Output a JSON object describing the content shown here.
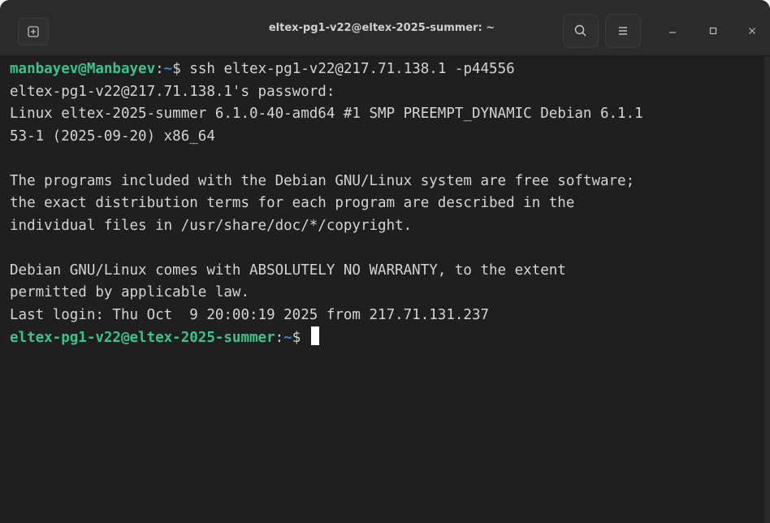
{
  "window": {
    "title": "eltex-pg1-v22@eltex-2025-summer: ~"
  },
  "titlebar": {
    "new_tab_icon": "new-tab-icon",
    "search_icon": "search-icon",
    "menu_icon": "hamburger-menu-icon",
    "minimize_icon": "minimize-icon",
    "maximize_icon": "maximize-icon",
    "close_icon": "close-icon"
  },
  "terminal": {
    "prompt1": {
      "user": "manbayev@Manbayev",
      "colon": ":",
      "path": "~",
      "symbol": "$ ",
      "command": "ssh eltex-pg1-v22@217.71.138.1 -p44556"
    },
    "output": [
      "eltex-pg1-v22@217.71.138.1's password:",
      "Linux eltex-2025-summer 6.1.0-40-amd64 #1 SMP PREEMPT_DYNAMIC Debian 6.1.1",
      "53-1 (2025-09-20) x86_64",
      "",
      "The programs included with the Debian GNU/Linux system are free software;",
      "the exact distribution terms for each program are described in the",
      "individual files in /usr/share/doc/*/copyright.",
      "",
      "Debian GNU/Linux comes with ABSOLUTELY NO WARRANTY, to the extent",
      "permitted by applicable law.",
      "Last login: Thu Oct  9 20:00:19 2025 from 217.71.131.237"
    ],
    "prompt2": {
      "user": "eltex-pg1-v22@eltex-2025-summer",
      "colon": ":",
      "path": "~",
      "symbol": "$ "
    }
  },
  "colors": {
    "background": "#1f1f1f",
    "titlebar": "#2b2b2b",
    "prompt_user": "#3cc28a",
    "prompt_path": "#2f86d6",
    "text": "#d4d4d4"
  }
}
